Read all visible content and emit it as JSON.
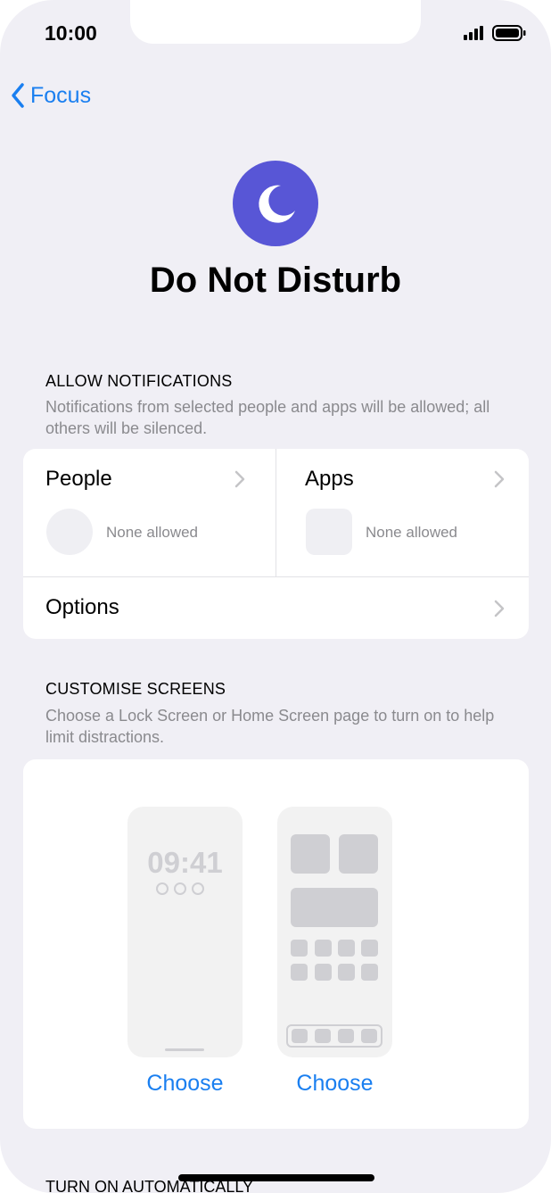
{
  "status_bar": {
    "time": "10:00"
  },
  "nav": {
    "back_label": "Focus"
  },
  "header": {
    "title": "Do Not Disturb",
    "icon": "moon-icon",
    "icon_color": "#5856d6"
  },
  "allow_notifications": {
    "heading": "ALLOW NOTIFICATIONS",
    "description": "Notifications from selected people and apps will be allowed; all others will be silenced.",
    "people": {
      "label": "People",
      "status": "None allowed"
    },
    "apps": {
      "label": "Apps",
      "status": "None allowed"
    },
    "options_label": "Options"
  },
  "customise_screens": {
    "heading": "CUSTOMISE SCREENS",
    "description": "Choose a Lock Screen or Home Screen page to turn on to help limit distractions.",
    "lock_preview_time": "09:41",
    "lock_choose": "Choose",
    "home_choose": "Choose"
  },
  "next_section": {
    "heading": "TURN ON AUTOMATICALLY"
  },
  "colors": {
    "accent": "#1a7ff0",
    "background": "#f0eff5"
  }
}
